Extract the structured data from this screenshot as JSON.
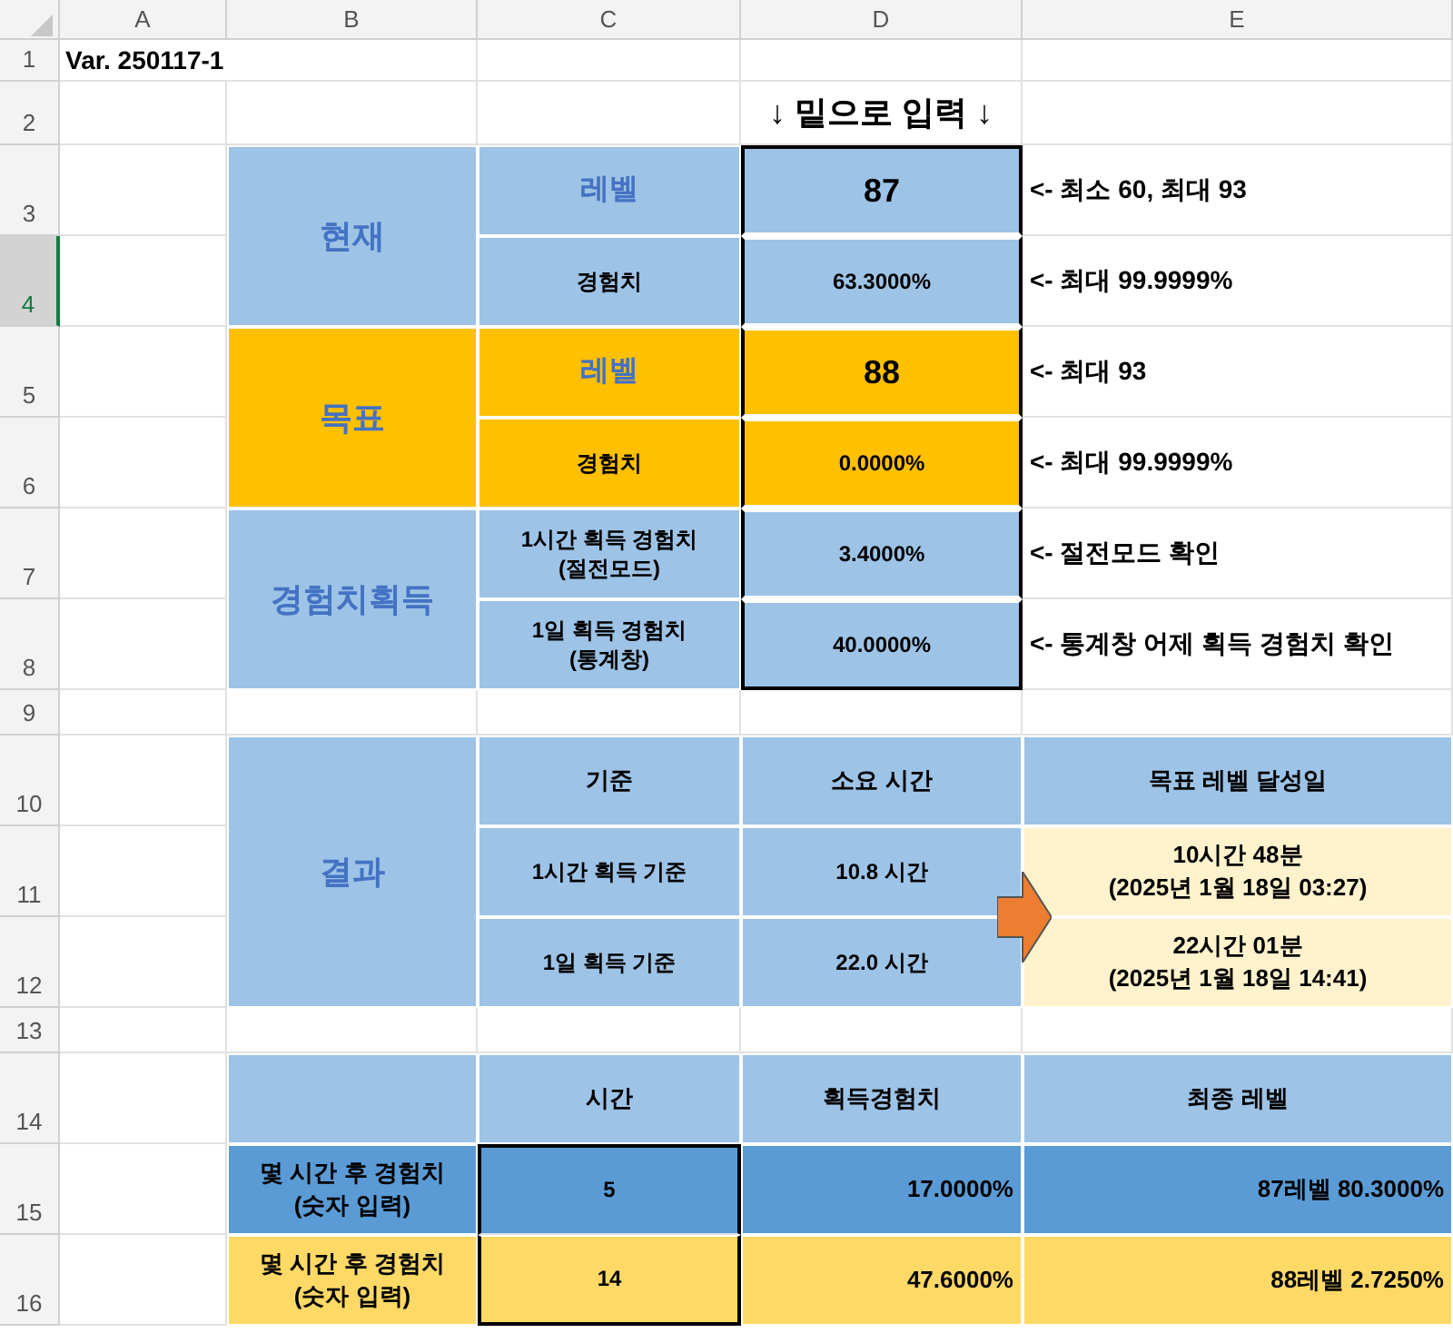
{
  "sheet": {
    "columns": [
      {
        "label": "A"
      },
      {
        "label": "B"
      },
      {
        "label": "C"
      },
      {
        "label": "D"
      },
      {
        "label": "E"
      }
    ],
    "rows": [
      {
        "label": "1",
        "selected": false
      },
      {
        "label": "2",
        "selected": false
      },
      {
        "label": "3",
        "selected": false
      },
      {
        "label": "4",
        "selected": true
      },
      {
        "label": "5",
        "selected": false
      },
      {
        "label": "6",
        "selected": false
      },
      {
        "label": "7",
        "selected": false
      },
      {
        "label": "8",
        "selected": false
      },
      {
        "label": "9",
        "selected": false
      },
      {
        "label": "10",
        "selected": false
      },
      {
        "label": "11",
        "selected": false
      },
      {
        "label": "12",
        "selected": false
      },
      {
        "label": "13",
        "selected": false
      },
      {
        "label": "14",
        "selected": false
      },
      {
        "label": "15",
        "selected": false
      },
      {
        "label": "16",
        "selected": false
      }
    ]
  },
  "version": "Var. 250117-1",
  "input_hint": "↓ 밑으로 입력 ↓",
  "groups": [
    {
      "label": "현재",
      "color": "#9dc3e6",
      "items": [
        {
          "kind": "level",
          "label": "레벨",
          "value": "87",
          "note": "<- 최소 60, 최대 93"
        },
        {
          "kind": "exp",
          "label": "경험치",
          "value": "63.3000%",
          "note": "<- 최대 99.9999%"
        }
      ]
    },
    {
      "label": "목표",
      "color": "#ffc000",
      "items": [
        {
          "kind": "level",
          "label": "레벨",
          "value": "88",
          "note": "<- 최대 93"
        },
        {
          "kind": "exp",
          "label": "경험치",
          "value": "0.0000%",
          "note": "<- 최대 99.9999%"
        }
      ]
    },
    {
      "label": "경험치획득",
      "color": "#9dc3e6",
      "items": [
        {
          "kind": "gain",
          "label": "1시간 획득 경험치\n(절전모드)",
          "value": "3.4000%",
          "note": "<- 절전모드 확인"
        },
        {
          "kind": "gain",
          "label": "1일 획득 경험치\n(통계창)",
          "value": "40.0000%",
          "note": "<- 통계창 어제 획득 경험치 확인"
        }
      ]
    }
  ],
  "result": {
    "label": "결과",
    "headers": [
      "기준",
      "소요 시간",
      "목표 레벨 달성일"
    ],
    "rows": [
      {
        "basis": "1시간 획득 기준",
        "time": "10.8 시간",
        "date": "10시간 48분\n(2025년 1월 18일 03:27)"
      },
      {
        "basis": "1일 획득 기준",
        "time": "22.0 시간",
        "date": "22시간 01분\n(2025년 1월 18일 14:41)"
      }
    ]
  },
  "projection": {
    "headers": [
      "시간",
      "획득경험치",
      "최종 레벨"
    ],
    "rows": [
      {
        "label": "몇 시간 후 경험치\n(숫자 입력)",
        "hours": "5",
        "gained": "17.0000%",
        "final": "87레벨 80.3000%",
        "color": "#5b9bd5"
      },
      {
        "label": "몇 시간 후 경험치\n(숫자 입력)",
        "hours": "14",
        "gained": "47.6000%",
        "final": "88레벨 2.7250%",
        "color": "#ffd966"
      }
    ]
  }
}
